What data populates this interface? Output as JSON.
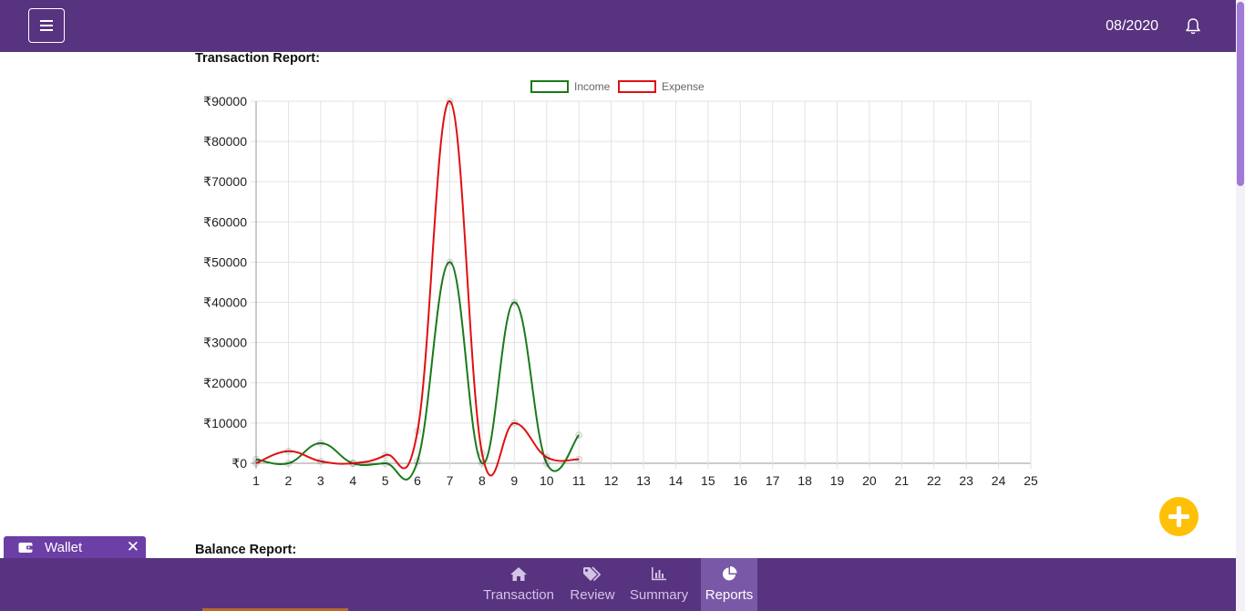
{
  "header": {
    "menu_icon": "hamburger-icon",
    "date": "08/2020",
    "bell_icon": "bell-icon"
  },
  "reports": {
    "transaction_title": "Transaction Report:",
    "balance_title": "Balance Report:"
  },
  "wallet_tab": {
    "label": "Wallet",
    "icon": "wallet-icon",
    "close": "✕"
  },
  "fab": {
    "icon": "plus-icon"
  },
  "bottom_nav": [
    {
      "id": "transaction",
      "label": "Transaction",
      "icon": "home-icon",
      "active": false
    },
    {
      "id": "review",
      "label": "Review",
      "icon": "tags-icon",
      "active": false
    },
    {
      "id": "summary",
      "label": "Summary",
      "icon": "bar-chart-icon",
      "active": false
    },
    {
      "id": "reports",
      "label": "Reports",
      "icon": "pie-chart-icon",
      "active": true
    }
  ],
  "colors": {
    "brand": "#583380",
    "active_nav": "#7a58a8",
    "fab": "#ffc107",
    "income": "#1a7a1a",
    "expense": "#e01010"
  },
  "chart_data": {
    "type": "line",
    "title": "",
    "xlabel": "",
    "ylabel": "",
    "legend_position": "top-center",
    "grid": true,
    "x": [
      1,
      2,
      3,
      4,
      5,
      6,
      7,
      8,
      9,
      10,
      11,
      12,
      13,
      14,
      15,
      16,
      17,
      18,
      19,
      20,
      21,
      22,
      23,
      24,
      25
    ],
    "x_tick_labels": [
      "1",
      "2",
      "3",
      "4",
      "5",
      "6",
      "7",
      "8",
      "9",
      "10",
      "11",
      "12",
      "13",
      "14",
      "15",
      "16",
      "17",
      "18",
      "19",
      "20",
      "21",
      "22",
      "23",
      "24",
      "25"
    ],
    "ylim": [
      0,
      90000
    ],
    "y_tick_labels": [
      "₹0",
      "₹10000",
      "₹20000",
      "₹30000",
      "₹40000",
      "₹50000",
      "₹60000",
      "₹70000",
      "₹80000",
      "₹90000"
    ],
    "series": [
      {
        "name": "Income",
        "color": "#1a7a1a",
        "x": [
          1,
          2,
          3,
          4,
          5,
          6,
          7,
          8,
          9,
          10,
          11
        ],
        "values": [
          1000,
          0,
          5000,
          0,
          0,
          500,
          50000,
          0,
          40000,
          0,
          7000
        ]
      },
      {
        "name": "Expense",
        "color": "#e01010",
        "x": [
          1,
          2,
          3,
          4,
          5,
          6,
          7,
          8,
          9,
          10,
          11
        ],
        "values": [
          0,
          3000,
          500,
          0,
          2000,
          8000,
          90000,
          2500,
          10000,
          1500,
          1000
        ]
      }
    ]
  }
}
